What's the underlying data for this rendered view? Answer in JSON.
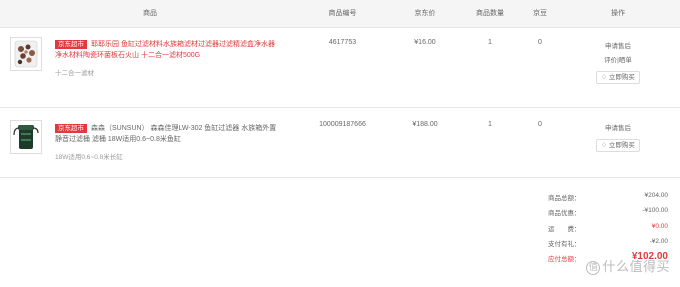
{
  "headers": {
    "product": "商品",
    "product_id": "商品编号",
    "jd_price": "京东价",
    "quantity": "商品数量",
    "jingdou": "京豆",
    "actions": "操作"
  },
  "items": [
    {
      "tag": "京东超市",
      "title": "耶耶乐园 鱼缸过滤材料水族箱滤材过滤器过滤精滤盒净水器净水材料陶瓷环菌板石火山 十二合一滤材500G",
      "spec": "十二合一滤材",
      "product_id": "4617753",
      "price": "¥16.00",
      "quantity": "1",
      "jingdou": "0",
      "action_aftersale": "申请售后",
      "action_review": "评价|晒单",
      "action_buy": "立即购买"
    },
    {
      "tag": "京东超市",
      "title": "森森（SUNSUN） 森森佳理LW-302 鱼缸过滤器 水族箱外置静音过滤桶 滤桶 18W适用0.6~0.8米鱼缸",
      "spec": "18W适用0.6~0.8米长缸",
      "product_id": "100009187666",
      "price": "¥188.00",
      "quantity": "1",
      "jingdou": "0",
      "action_aftersale": "申请售后",
      "action_buy": "立即购买"
    }
  ],
  "summary": {
    "total_label": "商品总额：",
    "total_value": "¥204.00",
    "discount_label": "商品优惠：",
    "discount_value": "-¥100.00",
    "shipping_label": "运　　费：",
    "shipping_value": "¥0.00",
    "cashback_label": "支付有礼：",
    "cashback_value": "-¥2.00",
    "paid_label": "应付总额：",
    "paid_value": "¥102.00"
  },
  "watermark": "什么值得买",
  "colors": {
    "accent_red": "#e4393c",
    "header_bg": "#f5f5f5",
    "border": "#e6e6e6"
  }
}
